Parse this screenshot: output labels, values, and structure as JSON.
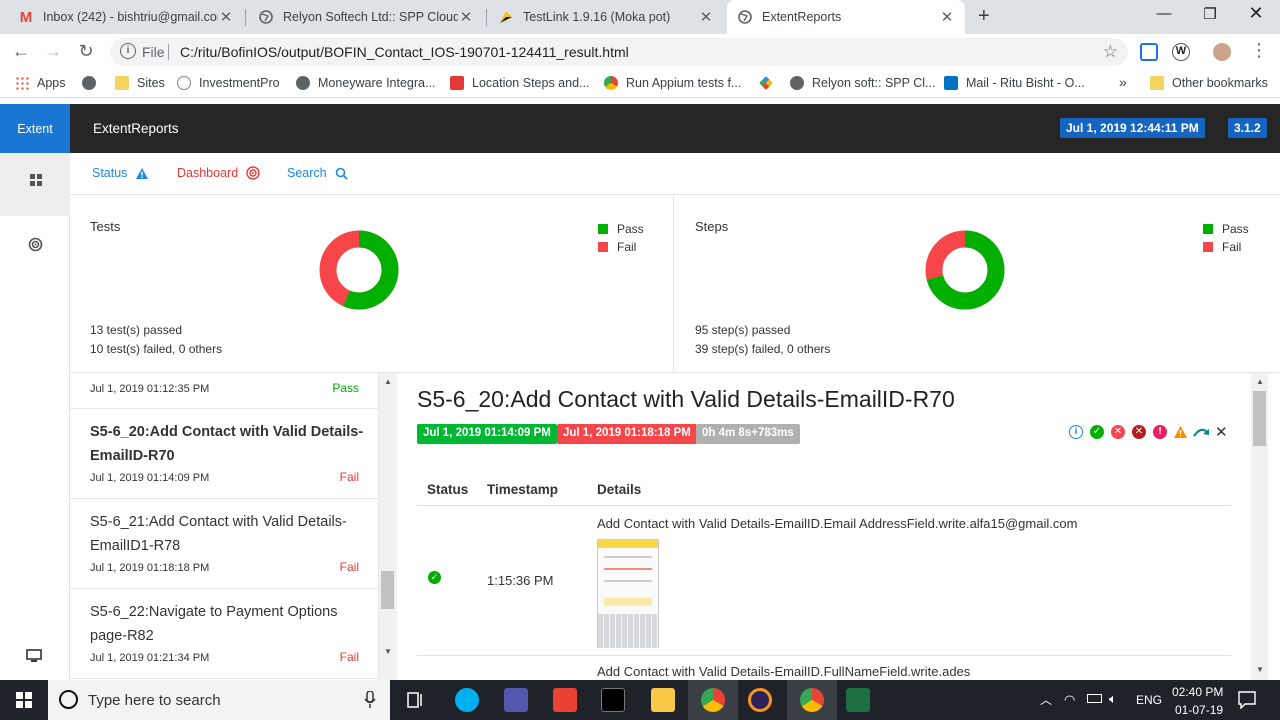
{
  "browser": {
    "tabs": [
      {
        "title": "Inbox (242) - bishtriu@gmail.com",
        "icon": "gmail-icon"
      },
      {
        "title": "Relyon Softech Ltd:: SPP Cloud",
        "icon": "globe-icon"
      },
      {
        "title": "TestLink 1.9.16 (Moka pot)",
        "icon": "testlink-icon"
      },
      {
        "title": "ExtentReports",
        "icon": "globe-icon"
      }
    ],
    "address": {
      "scheme_label": "File",
      "url": "C:/ritu/BofinIOS/output/BOFIN_Contact_IOS-190701-124411_result.html"
    },
    "bookmarks": [
      {
        "label": "Apps",
        "icon": "apps-grid-icon"
      },
      {
        "label": "",
        "icon": "globe-icon"
      },
      {
        "label": "Sites",
        "icon": "folder-icon"
      },
      {
        "label": "InvestmentPro",
        "icon": "cloud-icon"
      },
      {
        "label": "Moneyware Integra...",
        "icon": "globe-icon"
      },
      {
        "label": "Location Steps and...",
        "icon": "it-icon"
      },
      {
        "label": "Run Appium tests f...",
        "icon": "chrome-icon"
      },
      {
        "label": "",
        "icon": "pinwheel-icon"
      },
      {
        "label": "Relyon soft:: SPP Cl...",
        "icon": "globe-icon"
      },
      {
        "label": "Mail - Ritu Bisht - O...",
        "icon": "outlook-icon"
      }
    ],
    "bookmarks_overflow": "»",
    "other_bookmarks": "Other bookmarks"
  },
  "report": {
    "brand": "Extent",
    "title": "ExtentReports",
    "date": "Jul 1, 2019 12:44:11 PM",
    "version": "3.1.2"
  },
  "nav": {
    "status": "Status",
    "dashboard": "Dashboard",
    "search": "Search"
  },
  "dashboard": {
    "tests": {
      "title": "Tests",
      "legend": [
        "Pass",
        "Fail"
      ],
      "passed_text": "13 test(s) passed",
      "failed_text": "10 test(s) failed, 0 others",
      "pass": 13,
      "fail": 10
    },
    "steps": {
      "title": "Steps",
      "legend": [
        "Pass",
        "Fail"
      ],
      "passed_text": "95 step(s) passed",
      "failed_text": "39 step(s) failed, 0 others",
      "pass": 95,
      "fail": 39
    },
    "colors": {
      "pass": "#00af00",
      "fail": "#f7464a"
    }
  },
  "test_list": [
    {
      "name": "",
      "time": "Jul 1, 2019 01:12:35 PM",
      "status": "Pass"
    },
    {
      "name": "S5-6_20:Add Contact with Valid Details-EmailID-R70",
      "time": "Jul 1, 2019 01:14:09 PM",
      "status": "Fail"
    },
    {
      "name": "S5-6_21:Add Contact with Valid Details-EmailID1-R78",
      "time": "Jul 1, 2019 01:18:18 PM",
      "status": "Fail"
    },
    {
      "name": "S5-6_22:Navigate to Payment Options page-R82",
      "time": "Jul 1, 2019 01:21:34 PM",
      "status": "Fail"
    }
  ],
  "detail": {
    "title": "S5-6_20:Add Contact with Valid Details-EmailID-R70",
    "start": "Jul 1, 2019 01:14:09 PM",
    "end": "Jul 1, 2019 01:18:18 PM",
    "duration": "0h 4m 8s+783ms",
    "filter_icons": [
      "info-icon",
      "pass-icon",
      "fail-icon",
      "fatal-icon",
      "error-icon",
      "warning-icon",
      "skip-icon",
      "clear-icon"
    ],
    "columns": [
      "Status",
      "Timestamp",
      "Details"
    ],
    "rows": [
      {
        "status": "pass",
        "timestamp": "1:15:36 PM",
        "details": "Add Contact with Valid Details-EmailID.Email AddressField.write.alfa15@gmail.com"
      },
      {
        "status": "pass",
        "timestamp": "",
        "details": "Add Contact with Valid Details-EmailID.FullNameField.write.ades"
      }
    ]
  },
  "taskbar": {
    "search_placeholder": "Type here to search",
    "language": "ENG",
    "time": "02:40 PM",
    "date": "01-07-19"
  }
}
